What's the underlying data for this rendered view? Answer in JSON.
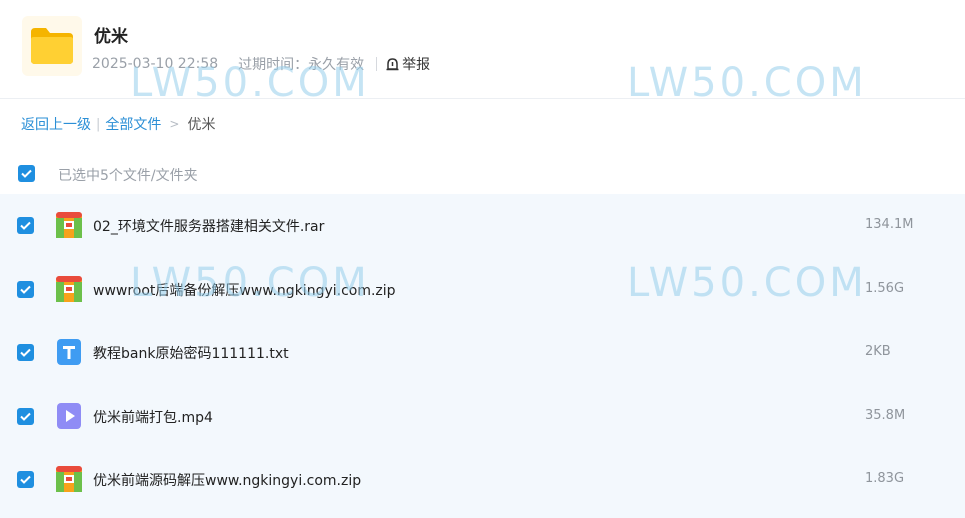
{
  "header": {
    "title": "优米",
    "date": "2025-03-10 22:58",
    "expire_label": "过期时间：",
    "expire_value": "永久有效",
    "report_label": "举报",
    "folder_icon": "folder-icon",
    "report_icon": "alert-icon"
  },
  "breadcrumb": {
    "back": "返回上一级",
    "all_files": "全部文件",
    "current": "优米"
  },
  "selection": {
    "text": "已选中5个文件/文件夹",
    "checked": true
  },
  "files": [
    {
      "name": "02_环境文件服务器搭建相关文件.rar",
      "size": "134.1M",
      "type": "archive",
      "checked": true
    },
    {
      "name": "wwwroot后端备份解压www.ngkingyi.com.zip",
      "size": "1.56G",
      "type": "archive",
      "checked": true
    },
    {
      "name": "教程bank原始密码111111.txt",
      "size": "2KB",
      "type": "text",
      "checked": true
    },
    {
      "name": "优米前端打包.mp4",
      "size": "35.8M",
      "type": "video",
      "checked": true
    },
    {
      "name": "优米前端源码解压www.ngkingyi.com.zip",
      "size": "1.83G",
      "type": "archive",
      "checked": true
    }
  ],
  "watermark": "LW50.COM",
  "colors": {
    "accent": "#1f8fe0",
    "link": "#2b8fd6",
    "list_bg": "#f3f8fd",
    "watermark": "#96cdeb"
  }
}
